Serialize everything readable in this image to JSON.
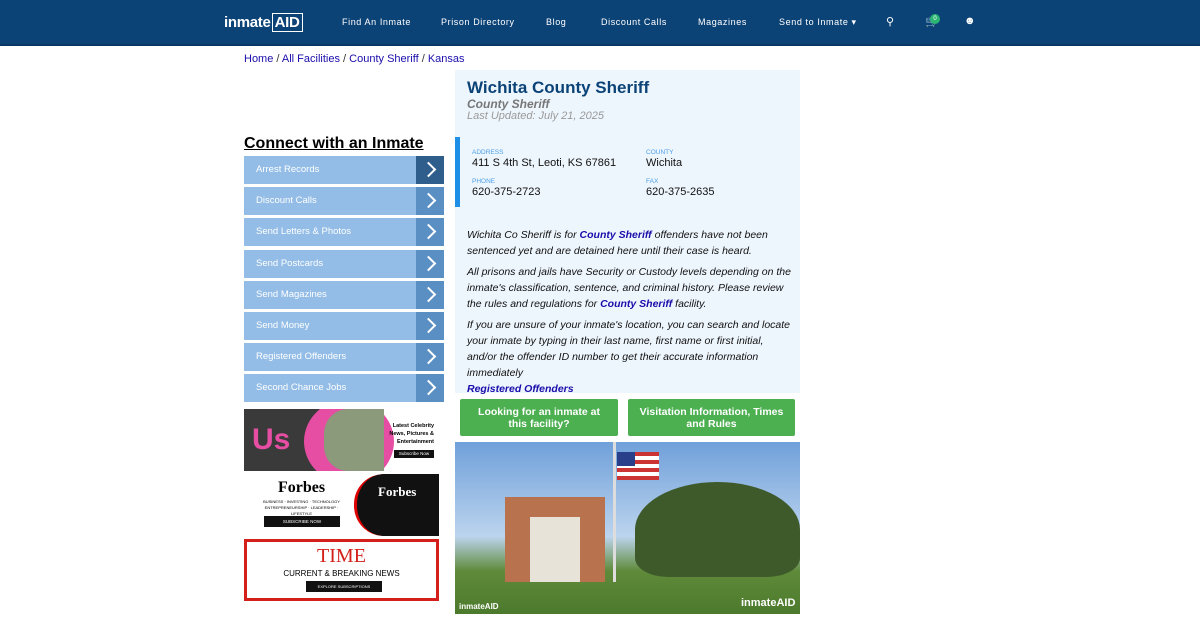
{
  "nav": {
    "logo": "inmateAID",
    "items": [
      "Find An Inmate",
      "Prison Directory",
      "Blog",
      "Discount Calls",
      "Magazines",
      "Send to Inmate ▾"
    ],
    "cart_count": "0",
    "icons": [
      "search-icon",
      "cart-icon",
      "user-icon"
    ]
  },
  "breadcrumb": [
    "Home",
    "All Facilities",
    "County Sheriff",
    "Kansas"
  ],
  "sidebar": {
    "heading": "Connect with an Inmate",
    "items": [
      "Arrest Records",
      "Discount Calls",
      "Send Letters & Photos",
      "Send Postcards",
      "Send Magazines",
      "Send Money",
      "Registered Offenders",
      "Second Chance Jobs"
    ]
  },
  "ads": {
    "us": {
      "logo": "Us",
      "text": "Latest Celebrity News, Pictures & Entertainment",
      "cta": "Subscribe Now"
    },
    "forbes": {
      "logo": "Forbes",
      "text": "BUSINESS · INVESTING · TECHNOLOGY ENTREPRENEURSHIP · LEADERSHIP · LIFESTYLE",
      "cta": "SUBSCRIBE NOW"
    },
    "time": {
      "logo": "TIME",
      "text": "CURRENT & BREAKING NEWS",
      "cta": "EXPLORE SUBSCRIPTIONS"
    }
  },
  "facility": {
    "name": "Wichita County Sheriff",
    "type": "County Sheriff",
    "updated": "Last Updated: July 21, 2025",
    "address_label": "ADDRESS",
    "address": "411 S 4th St, Leoti, KS 67861",
    "county_label": "COUNTY",
    "county": "Wichita",
    "phone_label": "PHONE",
    "phone": "620-375-2723",
    "fax_label": "FAX",
    "fax": "620-375-2635"
  },
  "description": {
    "p1a": "Wichita Co Sheriff is for ",
    "p1link": "County Sheriff",
    "p1b": " offenders have not been sentenced yet and are detained here until their case is heard.",
    "p2a": "All prisons and jails have Security or Custody levels depending on the inmate's classification, sentence, and criminal history. Please review the rules and regulations for ",
    "p2link": "County Sheriff",
    "p2b": " facility.",
    "p3": "If you are unsure of your inmate's location, you can search and locate your inmate by typing in their last name, first name or first initial, and/or the offender ID number to get their accurate information immediately",
    "p3link": "Registered Offenders"
  },
  "buttons": {
    "find": "Looking for an inmate at this facility?",
    "visit": "Visitation Information, Times and Rules"
  },
  "photo": {
    "watermark": "inmateAID"
  }
}
